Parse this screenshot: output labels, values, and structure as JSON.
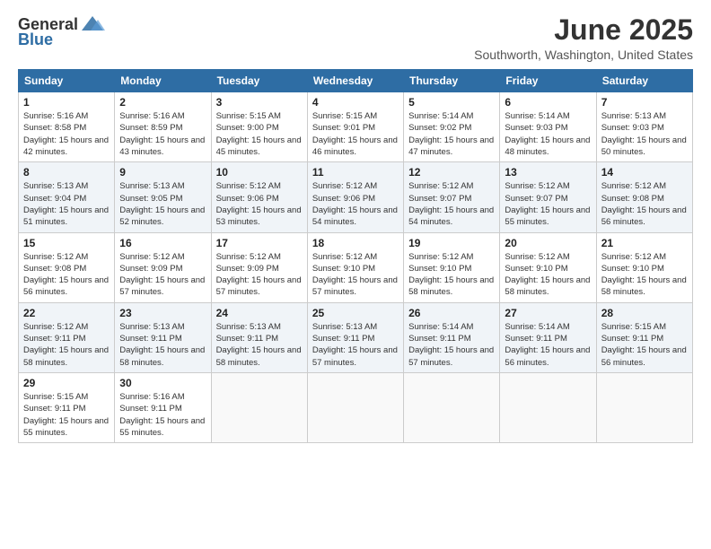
{
  "header": {
    "logo_general": "General",
    "logo_blue": "Blue",
    "month_title": "June 2025",
    "location": "Southworth, Washington, United States"
  },
  "columns": [
    "Sunday",
    "Monday",
    "Tuesday",
    "Wednesday",
    "Thursday",
    "Friday",
    "Saturday"
  ],
  "weeks": [
    [
      {
        "day": "1",
        "sunrise": "Sunrise: 5:16 AM",
        "sunset": "Sunset: 8:58 PM",
        "daylight": "Daylight: 15 hours and 42 minutes."
      },
      {
        "day": "2",
        "sunrise": "Sunrise: 5:16 AM",
        "sunset": "Sunset: 8:59 PM",
        "daylight": "Daylight: 15 hours and 43 minutes."
      },
      {
        "day": "3",
        "sunrise": "Sunrise: 5:15 AM",
        "sunset": "Sunset: 9:00 PM",
        "daylight": "Daylight: 15 hours and 45 minutes."
      },
      {
        "day": "4",
        "sunrise": "Sunrise: 5:15 AM",
        "sunset": "Sunset: 9:01 PM",
        "daylight": "Daylight: 15 hours and 46 minutes."
      },
      {
        "day": "5",
        "sunrise": "Sunrise: 5:14 AM",
        "sunset": "Sunset: 9:02 PM",
        "daylight": "Daylight: 15 hours and 47 minutes."
      },
      {
        "day": "6",
        "sunrise": "Sunrise: 5:14 AM",
        "sunset": "Sunset: 9:03 PM",
        "daylight": "Daylight: 15 hours and 48 minutes."
      },
      {
        "day": "7",
        "sunrise": "Sunrise: 5:13 AM",
        "sunset": "Sunset: 9:03 PM",
        "daylight": "Daylight: 15 hours and 50 minutes."
      }
    ],
    [
      {
        "day": "8",
        "sunrise": "Sunrise: 5:13 AM",
        "sunset": "Sunset: 9:04 PM",
        "daylight": "Daylight: 15 hours and 51 minutes."
      },
      {
        "day": "9",
        "sunrise": "Sunrise: 5:13 AM",
        "sunset": "Sunset: 9:05 PM",
        "daylight": "Daylight: 15 hours and 52 minutes."
      },
      {
        "day": "10",
        "sunrise": "Sunrise: 5:12 AM",
        "sunset": "Sunset: 9:06 PM",
        "daylight": "Daylight: 15 hours and 53 minutes."
      },
      {
        "day": "11",
        "sunrise": "Sunrise: 5:12 AM",
        "sunset": "Sunset: 9:06 PM",
        "daylight": "Daylight: 15 hours and 54 minutes."
      },
      {
        "day": "12",
        "sunrise": "Sunrise: 5:12 AM",
        "sunset": "Sunset: 9:07 PM",
        "daylight": "Daylight: 15 hours and 54 minutes."
      },
      {
        "day": "13",
        "sunrise": "Sunrise: 5:12 AM",
        "sunset": "Sunset: 9:07 PM",
        "daylight": "Daylight: 15 hours and 55 minutes."
      },
      {
        "day": "14",
        "sunrise": "Sunrise: 5:12 AM",
        "sunset": "Sunset: 9:08 PM",
        "daylight": "Daylight: 15 hours and 56 minutes."
      }
    ],
    [
      {
        "day": "15",
        "sunrise": "Sunrise: 5:12 AM",
        "sunset": "Sunset: 9:08 PM",
        "daylight": "Daylight: 15 hours and 56 minutes."
      },
      {
        "day": "16",
        "sunrise": "Sunrise: 5:12 AM",
        "sunset": "Sunset: 9:09 PM",
        "daylight": "Daylight: 15 hours and 57 minutes."
      },
      {
        "day": "17",
        "sunrise": "Sunrise: 5:12 AM",
        "sunset": "Sunset: 9:09 PM",
        "daylight": "Daylight: 15 hours and 57 minutes."
      },
      {
        "day": "18",
        "sunrise": "Sunrise: 5:12 AM",
        "sunset": "Sunset: 9:10 PM",
        "daylight": "Daylight: 15 hours and 57 minutes."
      },
      {
        "day": "19",
        "sunrise": "Sunrise: 5:12 AM",
        "sunset": "Sunset: 9:10 PM",
        "daylight": "Daylight: 15 hours and 58 minutes."
      },
      {
        "day": "20",
        "sunrise": "Sunrise: 5:12 AM",
        "sunset": "Sunset: 9:10 PM",
        "daylight": "Daylight: 15 hours and 58 minutes."
      },
      {
        "day": "21",
        "sunrise": "Sunrise: 5:12 AM",
        "sunset": "Sunset: 9:10 PM",
        "daylight": "Daylight: 15 hours and 58 minutes."
      }
    ],
    [
      {
        "day": "22",
        "sunrise": "Sunrise: 5:12 AM",
        "sunset": "Sunset: 9:11 PM",
        "daylight": "Daylight: 15 hours and 58 minutes."
      },
      {
        "day": "23",
        "sunrise": "Sunrise: 5:13 AM",
        "sunset": "Sunset: 9:11 PM",
        "daylight": "Daylight: 15 hours and 58 minutes."
      },
      {
        "day": "24",
        "sunrise": "Sunrise: 5:13 AM",
        "sunset": "Sunset: 9:11 PM",
        "daylight": "Daylight: 15 hours and 58 minutes."
      },
      {
        "day": "25",
        "sunrise": "Sunrise: 5:13 AM",
        "sunset": "Sunset: 9:11 PM",
        "daylight": "Daylight: 15 hours and 57 minutes."
      },
      {
        "day": "26",
        "sunrise": "Sunrise: 5:14 AM",
        "sunset": "Sunset: 9:11 PM",
        "daylight": "Daylight: 15 hours and 57 minutes."
      },
      {
        "day": "27",
        "sunrise": "Sunrise: 5:14 AM",
        "sunset": "Sunset: 9:11 PM",
        "daylight": "Daylight: 15 hours and 56 minutes."
      },
      {
        "day": "28",
        "sunrise": "Sunrise: 5:15 AM",
        "sunset": "Sunset: 9:11 PM",
        "daylight": "Daylight: 15 hours and 56 minutes."
      }
    ],
    [
      {
        "day": "29",
        "sunrise": "Sunrise: 5:15 AM",
        "sunset": "Sunset: 9:11 PM",
        "daylight": "Daylight: 15 hours and 55 minutes."
      },
      {
        "day": "30",
        "sunrise": "Sunrise: 5:16 AM",
        "sunset": "Sunset: 9:11 PM",
        "daylight": "Daylight: 15 hours and 55 minutes."
      },
      null,
      null,
      null,
      null,
      null
    ]
  ]
}
